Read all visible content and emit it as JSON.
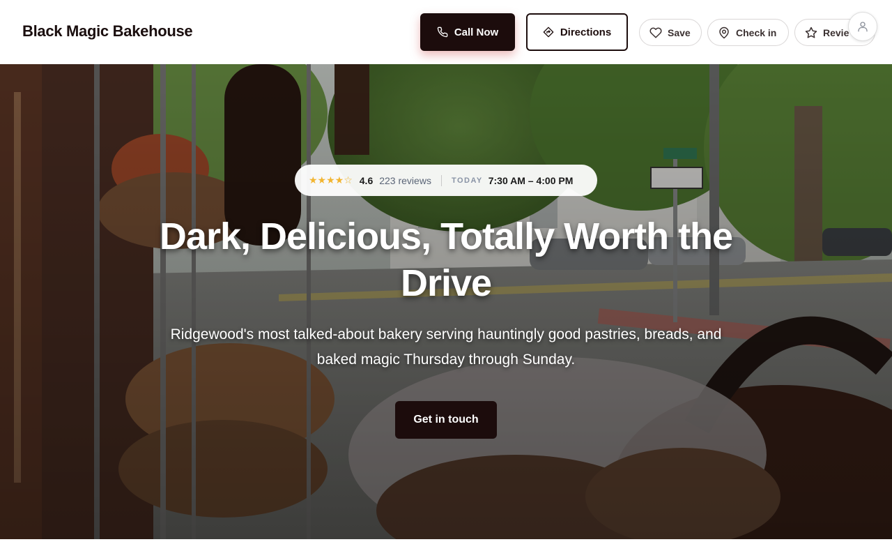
{
  "header": {
    "brand": "Black Magic Bakehouse",
    "call_label": "Call Now",
    "directions_label": "Directions",
    "save_label": "Save",
    "checkin_label": "Check in",
    "review_label": "Revie"
  },
  "hero": {
    "stars": "★★★★☆",
    "rating": "4.6",
    "reviews": "223 reviews",
    "today_label": "TODAY",
    "hours": "7:30 AM – 4:00 PM",
    "headline": "Dark, Delicious, Totally Worth the Drive",
    "subheadline": "Ridgewood's most talked-about bakery serving hauntingly good pastries, breads, and baked magic Thursday through Sunday.",
    "cta_label": "Get in touch"
  },
  "icons": {
    "call": "phone-icon",
    "directions": "directions-icon",
    "save": "heart-icon",
    "checkin": "map-pin-icon",
    "review": "star-icon",
    "account": "user-icon"
  },
  "colors": {
    "primary": "#1c0c0c",
    "star": "#f2b531",
    "muted": "#5b6577"
  }
}
